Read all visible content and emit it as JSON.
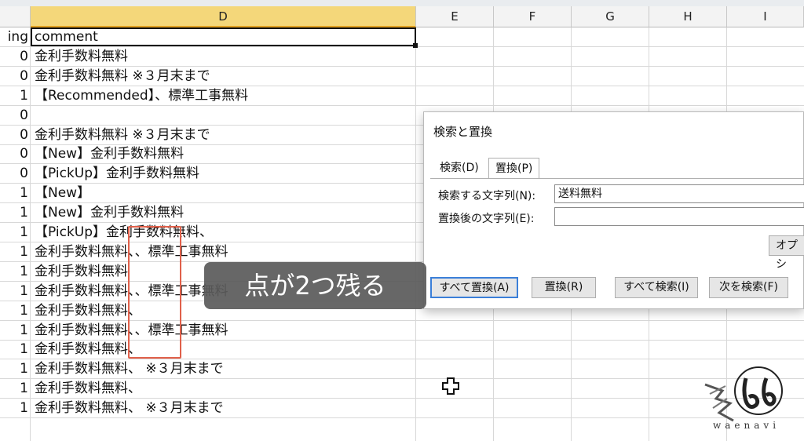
{
  "columns": {
    "D": "D",
    "E": "E",
    "F": "F",
    "G": "G",
    "H": "H",
    "I": "I"
  },
  "rows": [
    {
      "c": "ing",
      "d": "comment"
    },
    {
      "c": "0",
      "d": "金利手数料無料"
    },
    {
      "c": "0",
      "d": "金利手数料無料 ※３月末まで"
    },
    {
      "c": "1",
      "d": "【Recommended】、標準工事無料"
    },
    {
      "c": "0",
      "d": ""
    },
    {
      "c": "0",
      "d": "金利手数料無料 ※３月末まで"
    },
    {
      "c": "0",
      "d": "【New】金利手数料無料"
    },
    {
      "c": "0",
      "d": "【PickUp】金利手数料無料"
    },
    {
      "c": "1",
      "d": "【New】"
    },
    {
      "c": "1",
      "d": "【New】金利手数料無料"
    },
    {
      "c": "1",
      "d": "【PickUp】金利手数料無料、"
    },
    {
      "c": "1",
      "d": "金利手数料無料、、標準工事無料"
    },
    {
      "c": "1",
      "d": "金利手数料無料"
    },
    {
      "c": "1",
      "d": "金利手数料無料、、標準工事無料"
    },
    {
      "c": "1",
      "d": "金利手数料無料、"
    },
    {
      "c": "1",
      "d": "金利手数料無料、、標準工事無料"
    },
    {
      "c": "1",
      "d": "金利手数料無料、"
    },
    {
      "c": "1",
      "d": "金利手数料無料、 ※３月末まで"
    },
    {
      "c": "1",
      "d": "金利手数料無料、"
    },
    {
      "c": "1",
      "d": "金利手数料無料、 ※３月末まで"
    }
  ],
  "dialog": {
    "title": "検索と置換",
    "tabs": [
      "検索(D)",
      "置換(P)"
    ],
    "find_label": "検索する文字列(N):",
    "find_value": "送料無料",
    "replace_label": "置換後の文字列(E):",
    "replace_value": "",
    "options_label": "オプシ",
    "buttons": {
      "replace_all": "すべて置換(A)",
      "replace": "置換(R)",
      "find_all": "すべて検索(I)",
      "find_next": "次を検索(F)"
    }
  },
  "caption": "点が2つ残る",
  "watermark": "waenavi",
  "colors": {
    "selected_header": "#f4d77a",
    "highlight_box": "#e0604a",
    "caption_bg": "#5a5a5a",
    "primary_button_border": "#3b7fd8"
  }
}
